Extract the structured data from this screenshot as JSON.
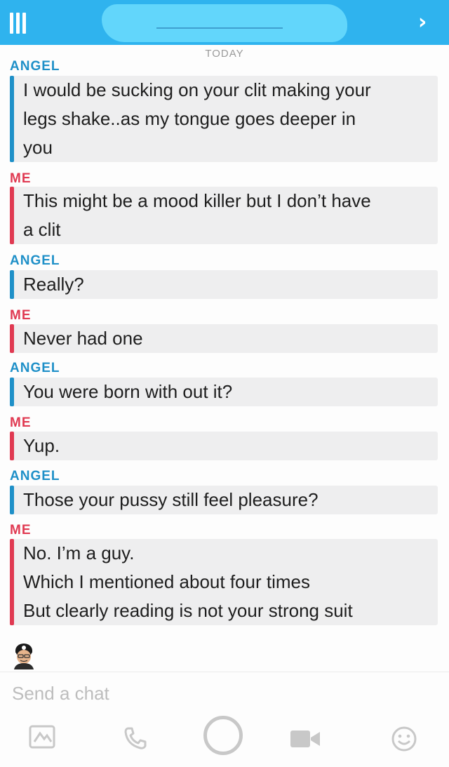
{
  "header": {
    "menu_icon": "menu-icon",
    "chevron_icon": "chevron-right-icon",
    "chevron_glyph": "›"
  },
  "chat": {
    "date_label": "TODAY",
    "messages": [
      {
        "sender": "ANGEL",
        "lines": [
          "I would be sucking on your clit making your",
          "legs shake..as my tongue goes deeper in",
          "you"
        ]
      },
      {
        "sender": "ME",
        "lines": [
          "This might be a mood killer but I don’t have",
          "a clit"
        ]
      },
      {
        "sender": "ANGEL",
        "lines": [
          "Really?"
        ]
      },
      {
        "sender": "ME",
        "lines": [
          "Never had one"
        ]
      },
      {
        "sender": "ANGEL",
        "lines": [
          "You were born with out it?"
        ]
      },
      {
        "sender": "ME",
        "lines": [
          "Yup."
        ]
      },
      {
        "sender": "ANGEL",
        "lines": [
          "Those your pussy still feel pleasure?"
        ]
      },
      {
        "sender": "ME",
        "lines": [
          "No. I’m a guy.",
          "Which I mentioned about four times",
          "But clearly reading is not your strong suit"
        ]
      }
    ]
  },
  "composer": {
    "placeholder": "Send a chat"
  },
  "toolbar": {
    "icons": [
      "sticker-card-icon",
      "phone-icon",
      "camera-shutter-icon",
      "video-call-icon",
      "smiley-icon"
    ]
  },
  "colors": {
    "header": "#2fb3ee",
    "angel": "#1f90c8",
    "me": "#e03a52",
    "bubble": "#eeeeef"
  }
}
